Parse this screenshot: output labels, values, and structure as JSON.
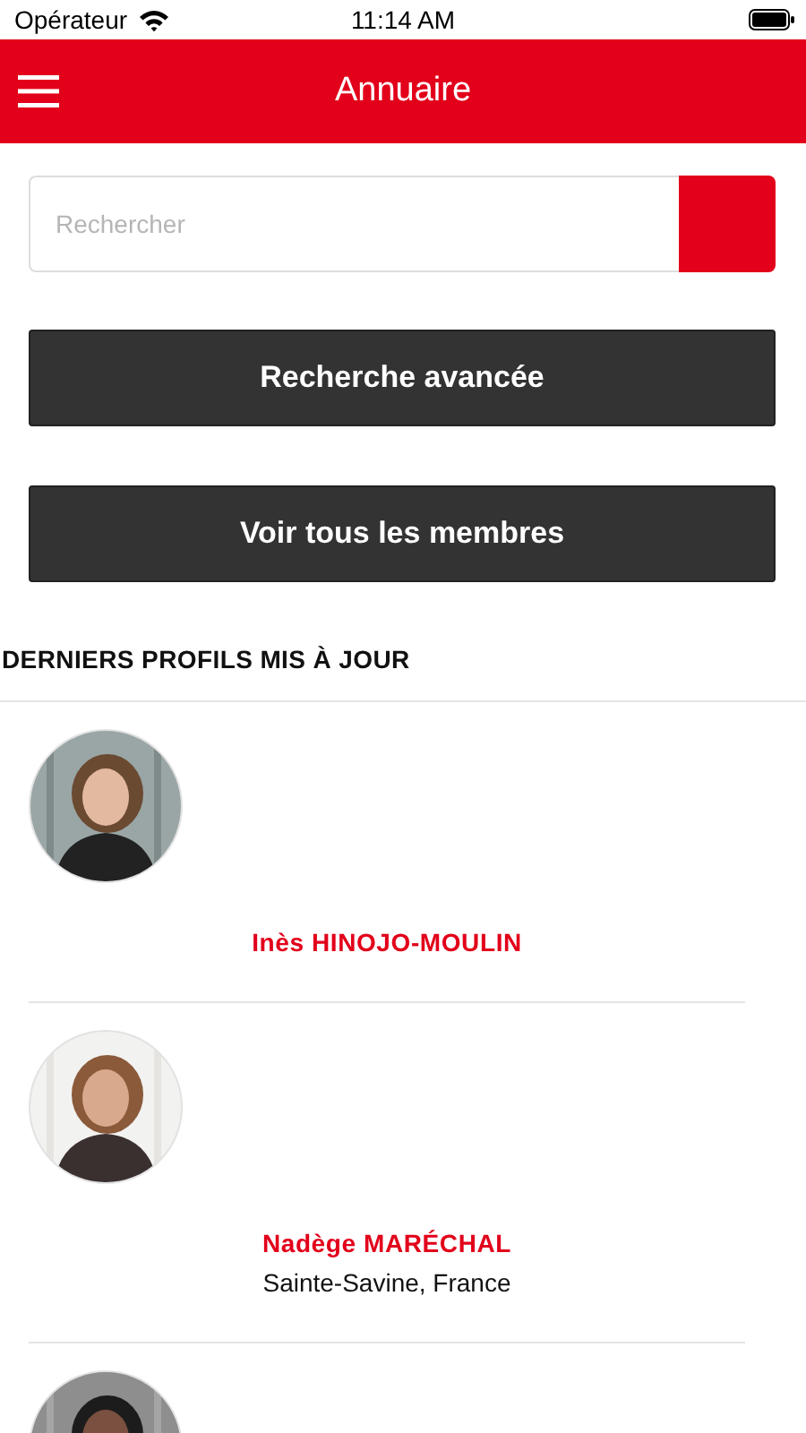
{
  "status_bar": {
    "carrier": "Opérateur",
    "time": "11:14 AM"
  },
  "header": {
    "title": "Annuaire"
  },
  "search": {
    "placeholder": "Rechercher"
  },
  "buttons": [
    "Recherche avancée",
    "Voir tous les membres"
  ],
  "section_title": "DERNIERS PROFILS MIS À JOUR",
  "profiles": [
    {
      "avatar": {
        "kind": "picture"
      },
      "name": "Inès HINOJO-MOULIN"
    },
    {
      "avatar": {
        "kind": "picture"
      },
      "name": "Nadège MARÉCHAL",
      "location": "Sainte-Savine, France"
    },
    {
      "avatar": {
        "kind": "picture"
      }
    }
  ]
}
